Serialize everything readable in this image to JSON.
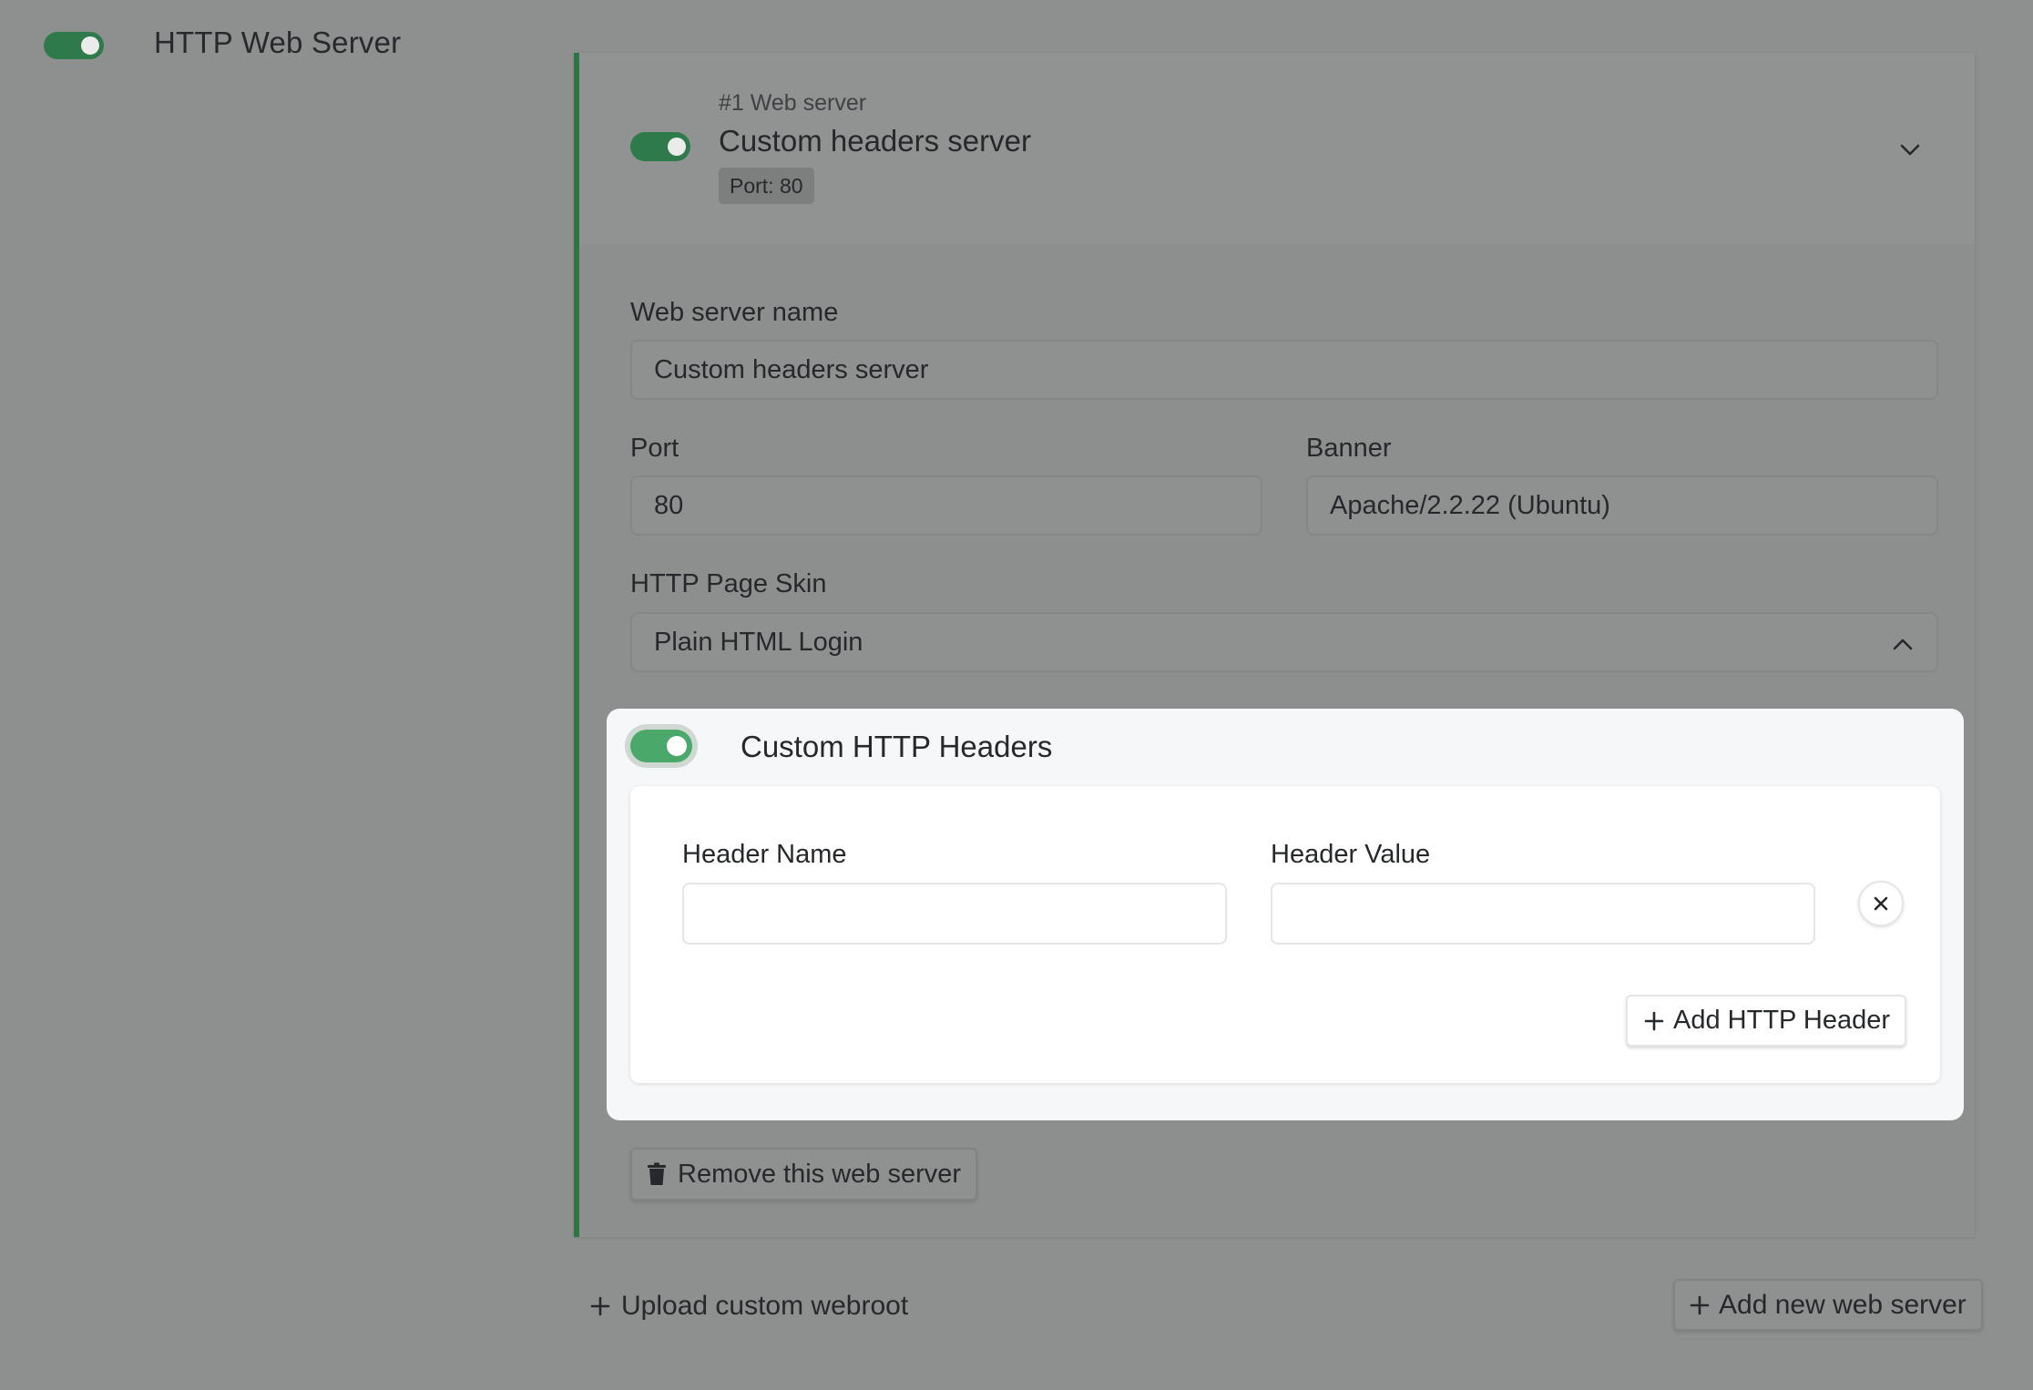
{
  "section": {
    "title": "HTTP Web Server",
    "enabled": true
  },
  "server": {
    "index_label": "#1 Web server",
    "title": "Custom headers server",
    "port_badge": "Port: 80",
    "enabled": true
  },
  "form": {
    "name_label": "Web server name",
    "name_value": "Custom headers server",
    "port_label": "Port",
    "port_value": "80",
    "banner_label": "Banner",
    "banner_value": "Apache/2.2.22 (Ubuntu)",
    "skin_label": "HTTP Page Skin",
    "skin_value": "Plain HTML Login"
  },
  "headers": {
    "title": "Custom HTTP Headers",
    "enabled": true,
    "name_label": "Header Name",
    "name_value": "",
    "value_label": "Header Value",
    "value_value": "",
    "add_label": "Add HTTP Header"
  },
  "actions": {
    "remove_server_label": "Remove this web server",
    "upload_webroot_label": "Upload custom webroot",
    "add_server_label": "Add new web server"
  },
  "colors": {
    "toggle_on_dim": "#2f7a4a",
    "toggle_on": "#4aa86a",
    "accent_bar": "#2d7546"
  }
}
